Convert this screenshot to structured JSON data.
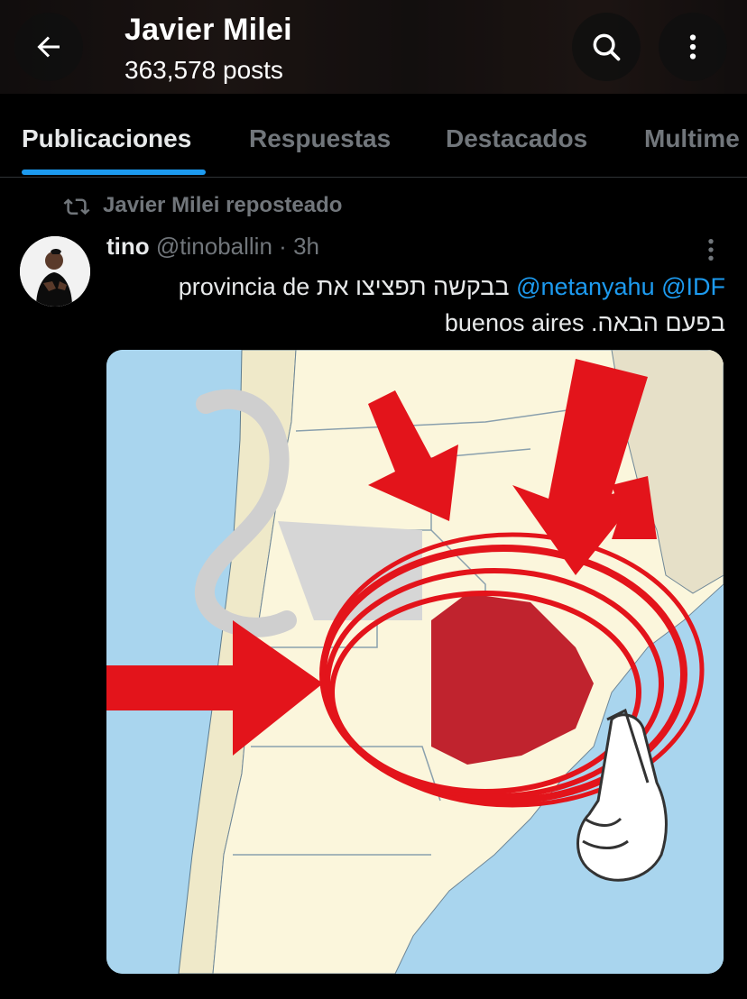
{
  "header": {
    "title": "Javier Milei",
    "subtitle": "363,578 posts"
  },
  "tabs": [
    {
      "label": "Publicaciones"
    },
    {
      "label": "Respuestas"
    },
    {
      "label": "Destacados"
    },
    {
      "label": "Multime"
    }
  ],
  "repost": {
    "label": "Javier Milei reposteado"
  },
  "post": {
    "name": "tino",
    "handle": "@tinoballin",
    "separator": "·",
    "time": "3h",
    "text_line1_links": "@netanyahu @IDF",
    "text_line1_hebrew": "בבקשה תפציצו את",
    "text_line1_spanish": "provincia de",
    "text_line2_spanish": "buenos aires",
    "text_line2_hebrew": "בפעם הבאה."
  },
  "colors": {
    "accent": "#1d9bf0",
    "text": "#e7e9ea",
    "muted": "#71767b",
    "background": "#000000",
    "map_red": "#e3141b",
    "province": "#c0232e"
  },
  "icons": {
    "back": "arrow-left-icon",
    "search": "search-icon",
    "more": "more-vertical-icon",
    "repost": "repost-icon"
  }
}
